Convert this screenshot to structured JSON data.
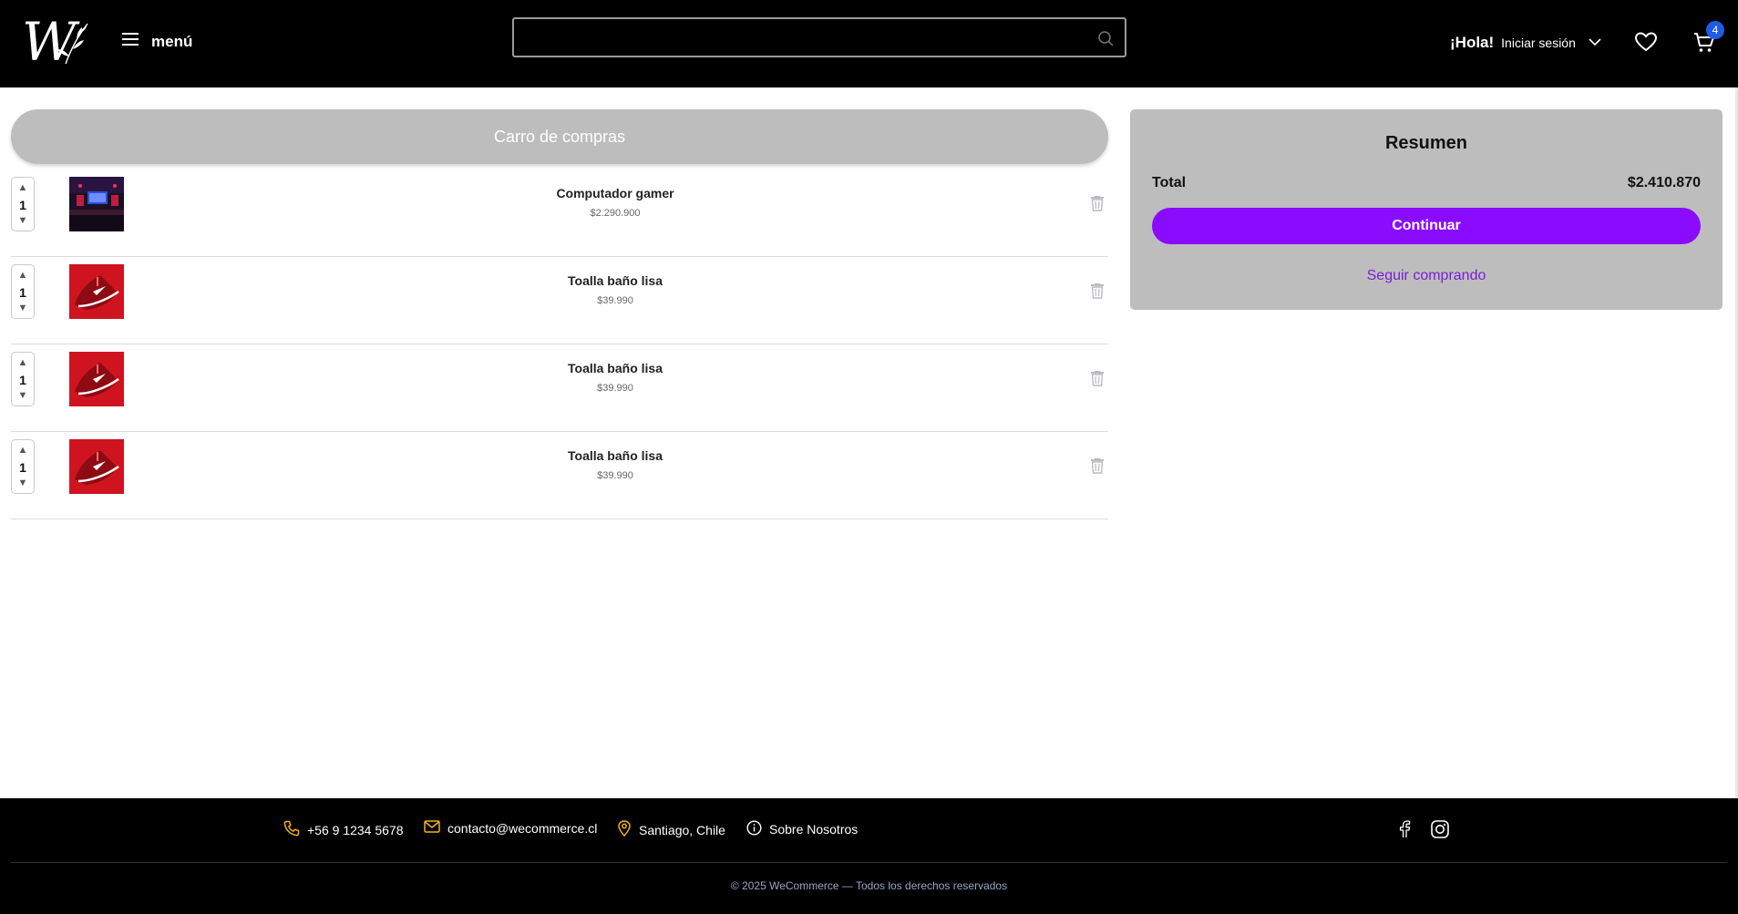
{
  "header": {
    "logo_alt": "W",
    "menu_label": "menú",
    "search": {
      "value": "",
      "placeholder": ""
    },
    "greeting": "¡Hola!",
    "login_label": "Iniciar sesión",
    "cart_count": "4"
  },
  "cart": {
    "title": "Carro de compras",
    "items": [
      {
        "quantity": "1",
        "name": "Computador gamer",
        "price": "$2.290.900"
      },
      {
        "quantity": "1",
        "name": "Toalla baño lisa",
        "price": "$39.990"
      },
      {
        "quantity": "1",
        "name": "Toalla baño lisa",
        "price": "$39.990"
      },
      {
        "quantity": "1",
        "name": "Toalla baño lisa",
        "price": "$39.990"
      }
    ]
  },
  "summary": {
    "title": "Resumen",
    "total_label": "Total",
    "total_value": "$2.410.870",
    "continue_label": "Continuar",
    "keep_shopping_label": "Seguir comprando"
  },
  "footer": {
    "phone": "+56 9 1234 5678",
    "email": "contacto@wecommerce.cl",
    "location": "Santiago, Chile",
    "about": "Sobre Nosotros",
    "copyright": "© 2025 WeCommerce — Todos los derechos reservados"
  },
  "colors": {
    "accent": "#8a0cff",
    "link": "#7a1fd6",
    "badge": "#1f5be8",
    "footer_icon": "#f2b21b"
  },
  "icons": [
    "menu-icon",
    "search-icon",
    "chevron-down-icon",
    "heart-icon",
    "cart-icon",
    "trash-icon",
    "phone-icon",
    "mail-icon",
    "location-pin-icon",
    "info-icon",
    "facebook-icon",
    "instagram-icon"
  ]
}
